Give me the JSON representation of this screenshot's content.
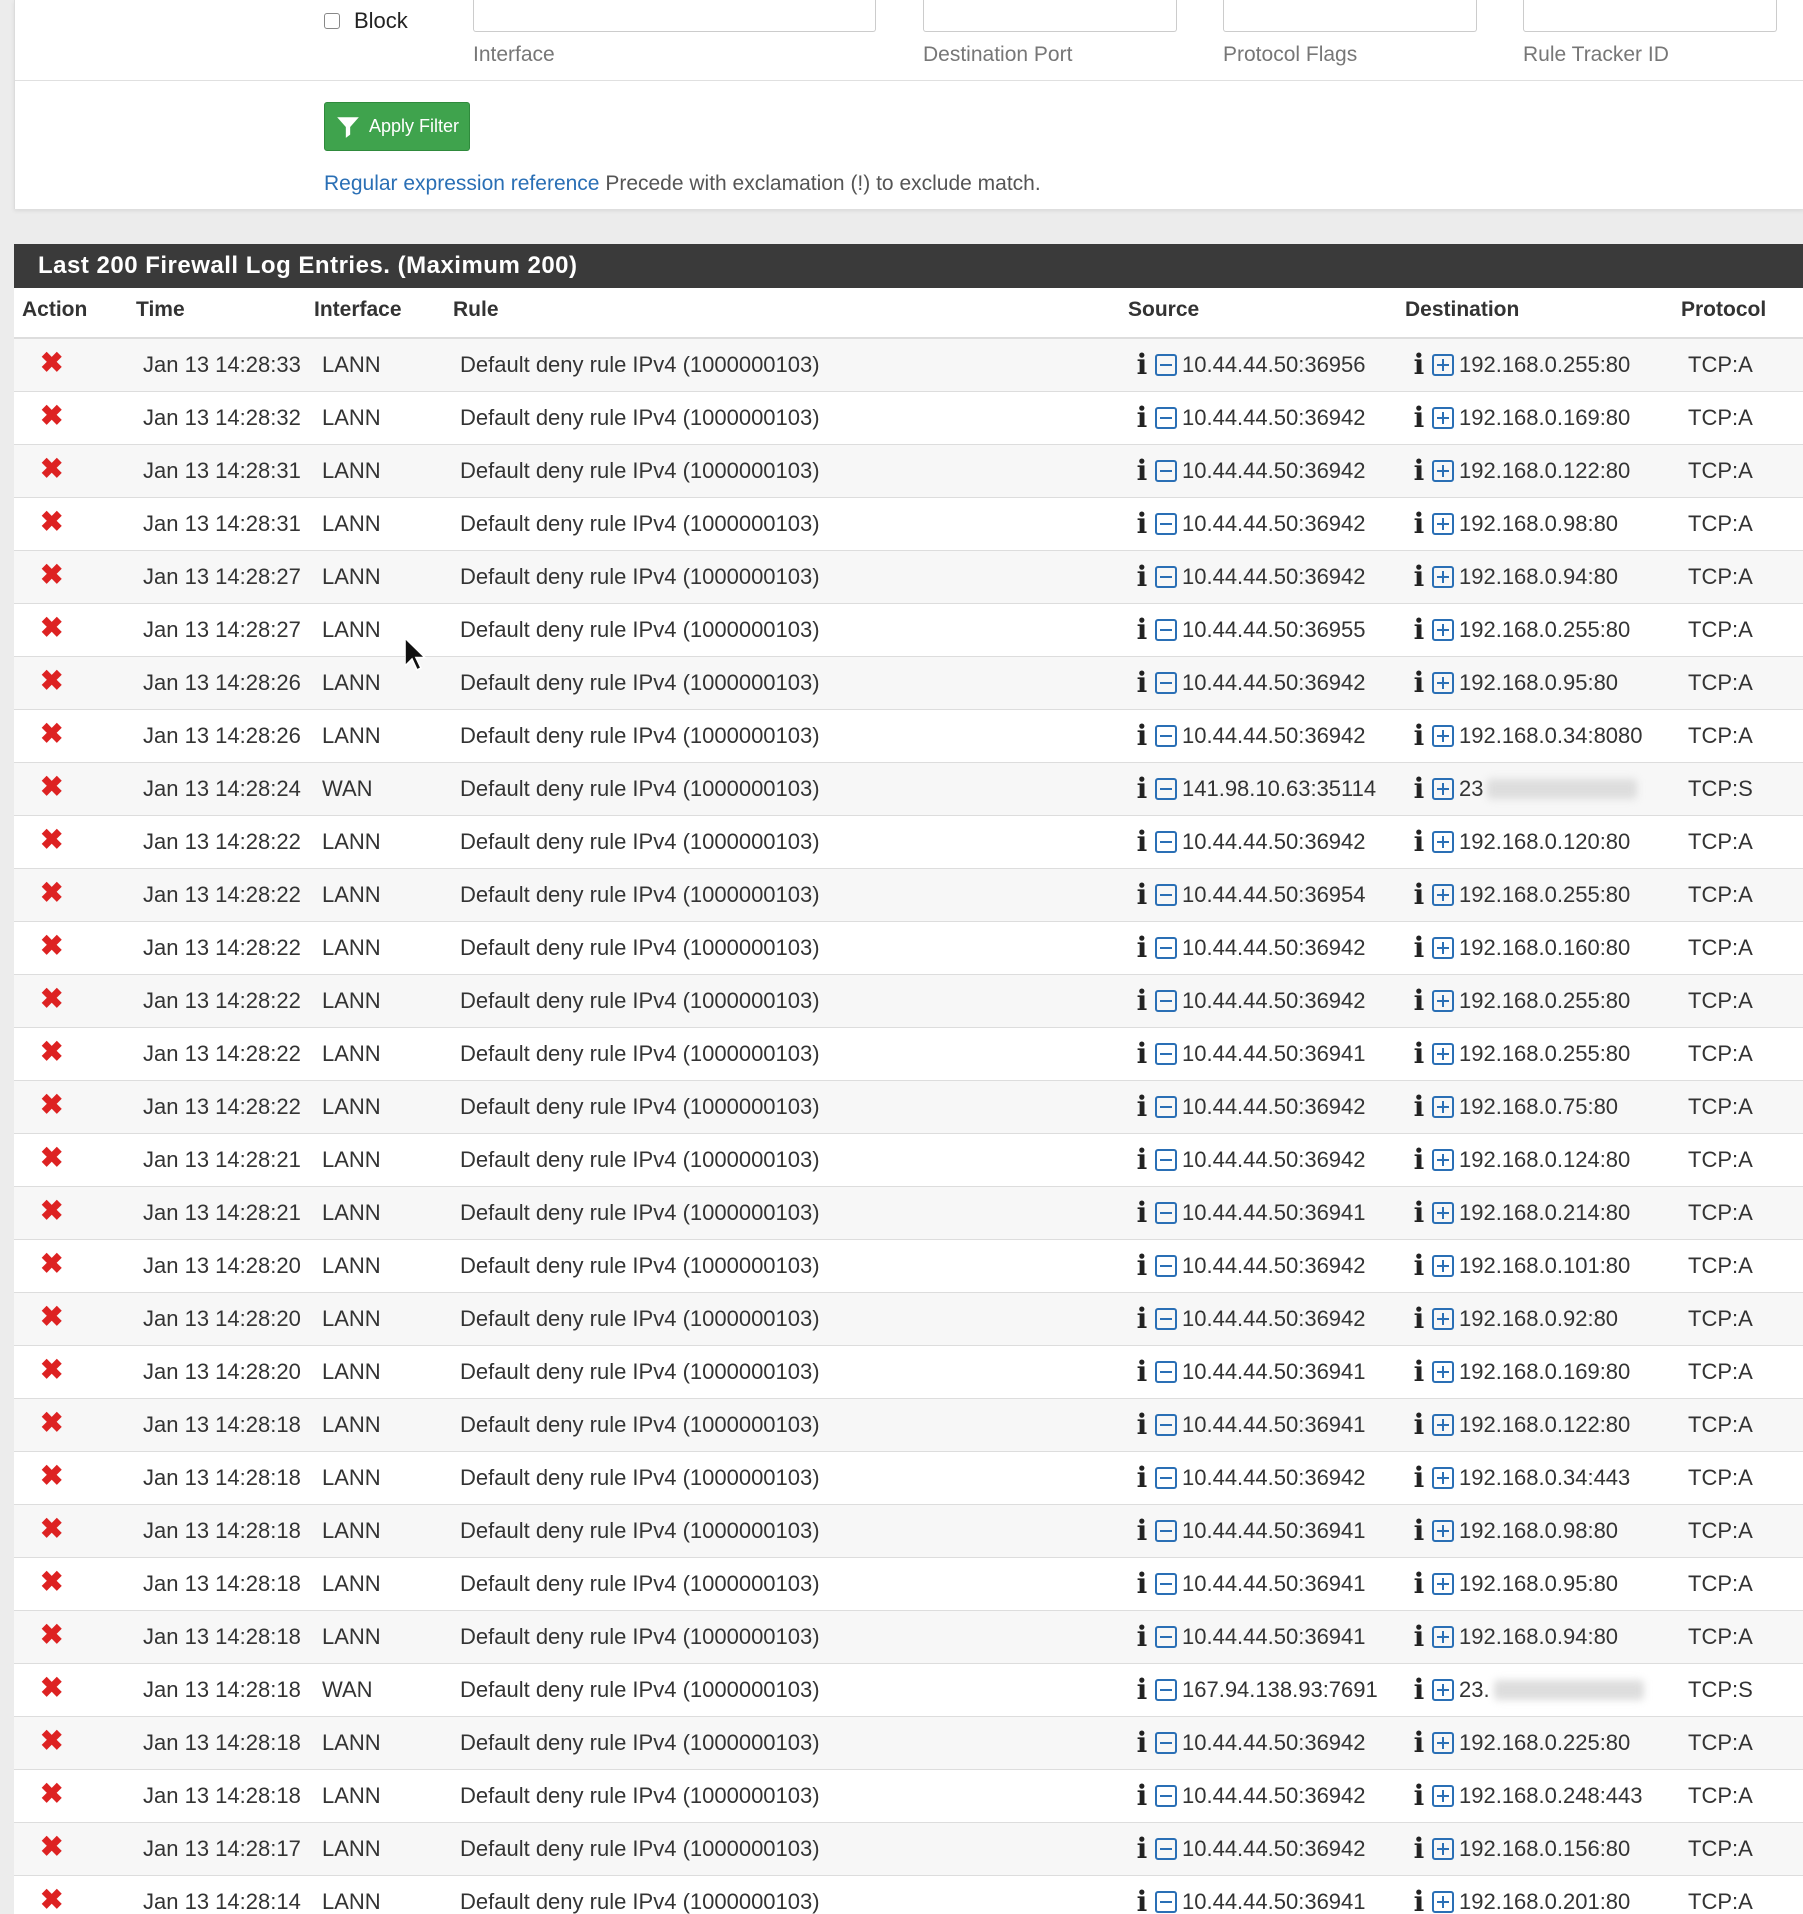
{
  "filter": {
    "block_label": "Block",
    "labels": {
      "interface": "Interface",
      "destination_port": "Destination Port",
      "protocol_flags": "Protocol Flags",
      "rule_tracker_id": "Rule Tracker ID"
    },
    "apply_label": "Apply Filter",
    "regex_link": "Regular expression reference",
    "regex_note": " Precede with exclamation (!) to exclude match."
  },
  "log": {
    "title": "Last 200 Firewall Log Entries. (Maximum 200)",
    "columns": [
      "Action",
      "Time",
      "Interface",
      "Rule",
      "Source",
      "Destination",
      "Protocol"
    ],
    "rows": [
      {
        "time": "Jan 13 14:28:33",
        "iface": "LANN",
        "rule": "Default deny rule IPv4 (1000000103)",
        "src": "10.44.44.50:36956",
        "dst": "192.168.0.255:80",
        "proto": "TCP:A"
      },
      {
        "time": "Jan 13 14:28:32",
        "iface": "LANN",
        "rule": "Default deny rule IPv4 (1000000103)",
        "src": "10.44.44.50:36942",
        "dst": "192.168.0.169:80",
        "proto": "TCP:A"
      },
      {
        "time": "Jan 13 14:28:31",
        "iface": "LANN",
        "rule": "Default deny rule IPv4 (1000000103)",
        "src": "10.44.44.50:36942",
        "dst": "192.168.0.122:80",
        "proto": "TCP:A"
      },
      {
        "time": "Jan 13 14:28:31",
        "iface": "LANN",
        "rule": "Default deny rule IPv4 (1000000103)",
        "src": "10.44.44.50:36942",
        "dst": "192.168.0.98:80",
        "proto": "TCP:A"
      },
      {
        "time": "Jan 13 14:28:27",
        "iface": "LANN",
        "rule": "Default deny rule IPv4 (1000000103)",
        "src": "10.44.44.50:36942",
        "dst": "192.168.0.94:80",
        "proto": "TCP:A"
      },
      {
        "time": "Jan 13 14:28:27",
        "iface": "LANN",
        "rule": "Default deny rule IPv4 (1000000103)",
        "src": "10.44.44.50:36955",
        "dst": "192.168.0.255:80",
        "proto": "TCP:A"
      },
      {
        "time": "Jan 13 14:28:26",
        "iface": "LANN",
        "rule": "Default deny rule IPv4 (1000000103)",
        "src": "10.44.44.50:36942",
        "dst": "192.168.0.95:80",
        "proto": "TCP:A"
      },
      {
        "time": "Jan 13 14:28:26",
        "iface": "LANN",
        "rule": "Default deny rule IPv4 (1000000103)",
        "src": "10.44.44.50:36942",
        "dst": "192.168.0.34:8080",
        "proto": "TCP:A"
      },
      {
        "time": "Jan 13 14:28:24",
        "iface": "WAN",
        "rule": "Default deny rule IPv4 (1000000103)",
        "src": "141.98.10.63:35114",
        "dst": "23",
        "dst_blurred": true,
        "proto": "TCP:S"
      },
      {
        "time": "Jan 13 14:28:22",
        "iface": "LANN",
        "rule": "Default deny rule IPv4 (1000000103)",
        "src": "10.44.44.50:36942",
        "dst": "192.168.0.120:80",
        "proto": "TCP:A"
      },
      {
        "time": "Jan 13 14:28:22",
        "iface": "LANN",
        "rule": "Default deny rule IPv4 (1000000103)",
        "src": "10.44.44.50:36954",
        "dst": "192.168.0.255:80",
        "proto": "TCP:A"
      },
      {
        "time": "Jan 13 14:28:22",
        "iface": "LANN",
        "rule": "Default deny rule IPv4 (1000000103)",
        "src": "10.44.44.50:36942",
        "dst": "192.168.0.160:80",
        "proto": "TCP:A"
      },
      {
        "time": "Jan 13 14:28:22",
        "iface": "LANN",
        "rule": "Default deny rule IPv4 (1000000103)",
        "src": "10.44.44.50:36942",
        "dst": "192.168.0.255:80",
        "proto": "TCP:A"
      },
      {
        "time": "Jan 13 14:28:22",
        "iface": "LANN",
        "rule": "Default deny rule IPv4 (1000000103)",
        "src": "10.44.44.50:36941",
        "dst": "192.168.0.255:80",
        "proto": "TCP:A"
      },
      {
        "time": "Jan 13 14:28:22",
        "iface": "LANN",
        "rule": "Default deny rule IPv4 (1000000103)",
        "src": "10.44.44.50:36942",
        "dst": "192.168.0.75:80",
        "proto": "TCP:A"
      },
      {
        "time": "Jan 13 14:28:21",
        "iface": "LANN",
        "rule": "Default deny rule IPv4 (1000000103)",
        "src": "10.44.44.50:36942",
        "dst": "192.168.0.124:80",
        "proto": "TCP:A"
      },
      {
        "time": "Jan 13 14:28:21",
        "iface": "LANN",
        "rule": "Default deny rule IPv4 (1000000103)",
        "src": "10.44.44.50:36941",
        "dst": "192.168.0.214:80",
        "proto": "TCP:A"
      },
      {
        "time": "Jan 13 14:28:20",
        "iface": "LANN",
        "rule": "Default deny rule IPv4 (1000000103)",
        "src": "10.44.44.50:36942",
        "dst": "192.168.0.101:80",
        "proto": "TCP:A"
      },
      {
        "time": "Jan 13 14:28:20",
        "iface": "LANN",
        "rule": "Default deny rule IPv4 (1000000103)",
        "src": "10.44.44.50:36942",
        "dst": "192.168.0.92:80",
        "proto": "TCP:A"
      },
      {
        "time": "Jan 13 14:28:20",
        "iface": "LANN",
        "rule": "Default deny rule IPv4 (1000000103)",
        "src": "10.44.44.50:36941",
        "dst": "192.168.0.169:80",
        "proto": "TCP:A"
      },
      {
        "time": "Jan 13 14:28:18",
        "iface": "LANN",
        "rule": "Default deny rule IPv4 (1000000103)",
        "src": "10.44.44.50:36941",
        "dst": "192.168.0.122:80",
        "proto": "TCP:A"
      },
      {
        "time": "Jan 13 14:28:18",
        "iface": "LANN",
        "rule": "Default deny rule IPv4 (1000000103)",
        "src": "10.44.44.50:36942",
        "dst": "192.168.0.34:443",
        "proto": "TCP:A"
      },
      {
        "time": "Jan 13 14:28:18",
        "iface": "LANN",
        "rule": "Default deny rule IPv4 (1000000103)",
        "src": "10.44.44.50:36941",
        "dst": "192.168.0.98:80",
        "proto": "TCP:A"
      },
      {
        "time": "Jan 13 14:28:18",
        "iface": "LANN",
        "rule": "Default deny rule IPv4 (1000000103)",
        "src": "10.44.44.50:36941",
        "dst": "192.168.0.95:80",
        "proto": "TCP:A"
      },
      {
        "time": "Jan 13 14:28:18",
        "iface": "LANN",
        "rule": "Default deny rule IPv4 (1000000103)",
        "src": "10.44.44.50:36941",
        "dst": "192.168.0.94:80",
        "proto": "TCP:A"
      },
      {
        "time": "Jan 13 14:28:18",
        "iface": "WAN",
        "rule": "Default deny rule IPv4 (1000000103)",
        "src": "167.94.138.93:7691",
        "dst": "23.",
        "dst_blurred": true,
        "proto": "TCP:S"
      },
      {
        "time": "Jan 13 14:28:18",
        "iface": "LANN",
        "rule": "Default deny rule IPv4 (1000000103)",
        "src": "10.44.44.50:36942",
        "dst": "192.168.0.225:80",
        "proto": "TCP:A"
      },
      {
        "time": "Jan 13 14:28:18",
        "iface": "LANN",
        "rule": "Default deny rule IPv4 (1000000103)",
        "src": "10.44.44.50:36942",
        "dst": "192.168.0.248:443",
        "proto": "TCP:A"
      },
      {
        "time": "Jan 13 14:28:17",
        "iface": "LANN",
        "rule": "Default deny rule IPv4 (1000000103)",
        "src": "10.44.44.50:36942",
        "dst": "192.168.0.156:80",
        "proto": "TCP:A"
      },
      {
        "time": "Jan 13 14:28:14",
        "iface": "LANN",
        "rule": "Default deny rule IPv4 (1000000103)",
        "src": "10.44.44.50:36941",
        "dst": "192.168.0.201:80",
        "proto": "TCP:A"
      }
    ]
  },
  "icons": {
    "action_block": "close-icon",
    "info": "info-icon",
    "source_toggle": "minus-square-icon",
    "destination_toggle": "plus-square-icon",
    "filter": "filter-icon"
  },
  "colors": {
    "header_bg": "#3a3a3a",
    "apply_button": "#3fa34d",
    "link": "#2a6fb5",
    "block_x": "#dd2222"
  }
}
